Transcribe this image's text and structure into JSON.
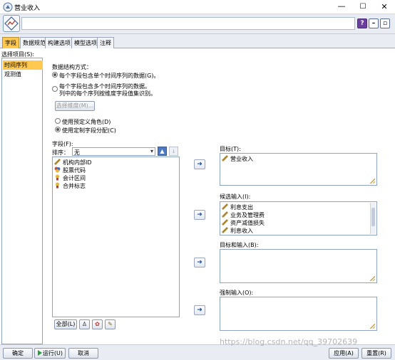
{
  "window": {
    "title": "营业收入",
    "min_glyph": "—",
    "max_glyph": "☐",
    "close_glyph": "✕"
  },
  "toolbar": {
    "node_name_value": "",
    "help_label": "?",
    "minimize_label": "–",
    "maximize_label": "▫"
  },
  "tabs": [
    {
      "label": "字段",
      "active": true
    },
    {
      "label": "数据规范",
      "active": false
    },
    {
      "label": "构建选项",
      "active": false
    },
    {
      "label": "模型选项",
      "active": false
    },
    {
      "label": "注释",
      "active": false
    }
  ],
  "left_panel": {
    "label": "选择项目(S):",
    "items": [
      {
        "label": "时间序列",
        "selected": true
      },
      {
        "label": "观测值",
        "selected": false
      }
    ]
  },
  "structure": {
    "heading": "数据结构方式：",
    "option_single": "每个字段包含单个时间序列的数据(G)。",
    "option_multi_line1": "每个字段包含多个时间序列的数据。",
    "option_multi_line2": "列中的每个序列按维度字段值集识别。",
    "select_dimension_button": "选择维度(M)...",
    "use_predefined": "使用预定义角色(D)",
    "use_custom": "使用定制字段分配(C)"
  },
  "fields": {
    "label": "字段(F):",
    "sort_label": "排序：",
    "sort_value": "无",
    "items": [
      {
        "label": "机构内部ID",
        "icon": "continuous-ruler-icon"
      },
      {
        "label": "股票代码",
        "icon": "nominal-set-icon"
      },
      {
        "label": "会计区间",
        "icon": "flag-icon"
      },
      {
        "label": "合并标志",
        "icon": "flag-icon"
      }
    ],
    "all_button": "全部(L)"
  },
  "target": {
    "label": "目标(T):",
    "items": [
      {
        "label": "营业收入",
        "icon": "continuous-ruler-icon"
      }
    ]
  },
  "candidates": {
    "label": "候选输入(I):",
    "items": [
      {
        "label": "利息支出",
        "icon": "continuous-ruler-icon"
      },
      {
        "label": "业务及管理费",
        "icon": "continuous-ruler-icon"
      },
      {
        "label": "资产减值损失",
        "icon": "continuous-ruler-icon"
      },
      {
        "label": "利息收入",
        "icon": "continuous-ruler-icon"
      }
    ]
  },
  "target_and_input": {
    "label": "目标和输入(B):"
  },
  "forced_input": {
    "label": "强制输入(O):"
  },
  "footer": {
    "ok_button": "确定",
    "run_button": "运行(U)",
    "cancel_button": "取消",
    "apply_button": "应用(A)",
    "reset_button": "重置(R)"
  },
  "watermark": "https://blog.csdn.net/qq_39702639",
  "colors": {
    "accent_tab": "#fec851",
    "selected_item": "#fec851",
    "arrow_blue": "#1b4da0"
  }
}
